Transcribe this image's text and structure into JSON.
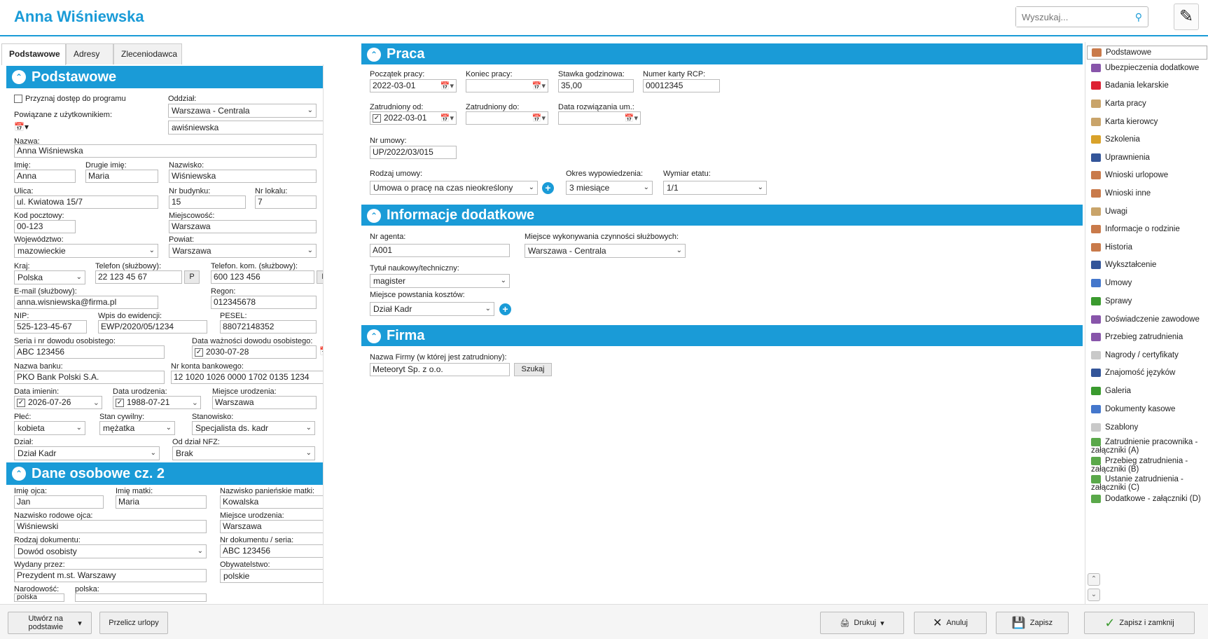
{
  "header": {
    "title": "Anna Wiśniewska",
    "search_placeholder": "Wyszukaj..."
  },
  "tabs": [
    "Podstawowe",
    "Adresy",
    "Zleceniodawca"
  ],
  "sections": {
    "podstawowe": "Podstawowe",
    "dane2": "Dane osobowe cz. 2",
    "praca": "Praca",
    "info": "Informacje dodatkowe",
    "firma": "Firma"
  },
  "podstawowe": {
    "przyznaj_label": "Przyznaj dostęp do programu",
    "oddzial_label": "Oddział:",
    "oddzial": "Warszawa - Centrala",
    "powiazane_label": "Powiązane z użytkownikiem:",
    "uzytkownik": "awiśniewska",
    "nazwa_label": "Nazwa:",
    "nazwa": "Anna Wiśniewska",
    "imie_label": "Imię:",
    "imie": "Anna",
    "drugie_label": "Drugie imię:",
    "drugie": "Maria",
    "nazwisko_label": "Nazwisko:",
    "nazwisko": "Wiśniewska",
    "ulica_label": "Ulica:",
    "ulica": "ul. Kwiatowa 15/7",
    "nrbud_label": "Nr budynku:",
    "nrbud": "15",
    "nrlok_label": "Nr lokalu:",
    "nrlok": "7",
    "kod_label": "Kod pocztowy:",
    "kod": "00-123",
    "miejsc_label": "Miejscowość:",
    "miejsc": "Warszawa",
    "woj_label": "Województwo:",
    "woj": "mazowieckie",
    "powiat_label": "Powiat:",
    "powiat": "Warszawa",
    "kraj_label": "Kraj:",
    "kraj": "Polska",
    "tel_label": "Telefon (służbowy):",
    "tel": "22 123 45 67",
    "telkom_label": "Telefon. kom. (służbowy):",
    "telkom": "600 123 456",
    "p": "P",
    "email_label": "E-mail (służbowy):",
    "email": "anna.wisniewska@firma.pl",
    "regon_label": "Regon:",
    "regon": "012345678",
    "nip_label": "NIP:",
    "nip": "525-123-45-67",
    "wpis_label": "Wpis do ewidencji:",
    "wpis": "EWP/2020/05/1234",
    "pesel_label": "PESEL:",
    "pesel": "88072148352",
    "dowod_label": "Seria i nr dowodu osobistego:",
    "dowod": "ABC 123456",
    "wazn_label": "Data ważności dowodu osobistego:",
    "wazn": "2030-07-28",
    "bank_label": "Nazwa banku:",
    "bank": "PKO Bank Polski S.A.",
    "konto_label": "Nr konta bankowego:",
    "konto": "12 1020 1026 0000 1702 0135 1234",
    "dimien_label": "Data imienin:",
    "dimien": "2026-07-26",
    "dur_label": "Data urodzenia:",
    "dur": "1988-07-21",
    "mur_label": "Miejsce urodzenia:",
    "mur": "Warszawa",
    "plec_label": "Płeć:",
    "plec": "kobieta",
    "stan_label": "Stan cywilny:",
    "stan": "mężatka",
    "stan_ow_label": "Stanowisko:",
    "stanowisko": "Specjalista ds. kadr",
    "dzial_label": "Dział:",
    "dzial": "Dział Kadr",
    "nfz_label": "Od dział NFZ:",
    "nfz": "Brak"
  },
  "dane2": {
    "ojciec_label": "Imię ojca:",
    "ojciec": "Jan",
    "matka_label": "Imię matki:",
    "matka": "Maria",
    "panienskie_label": "Nazwisko panieńskie matki:",
    "panienskie": "Kowalska",
    "rodowe_label": "Nazwisko rodowe ojca:",
    "rodowe": "Wiśniewski",
    "mur_label": "Miejsce urodzenia:",
    "mur": "Warszawa",
    "rdok_label": "Rodzaj dokumentu:",
    "rdok": "Dowód osobisty",
    "nrdok_label": "Nr dokumentu / seria:",
    "nrdok": "ABC 123456",
    "wydany_label": "Wydany przez:",
    "wydany": "Prezydent m.st. Warszawy",
    "obyw_label": "Obywatelstwo:",
    "obyw": "polskie",
    "narod_label": "Narodowość:",
    "narod": "polska",
    "polska_label": "polska:"
  },
  "praca": {
    "pocz_label": "Początek pracy:",
    "pocz": "2022-03-01",
    "koniec_label": "Koniec pracy:",
    "koniec": "",
    "stawka_label": "Stawka godzinowa:",
    "stawka": "35,00",
    "rcp_label": "Numer karty RCP:",
    "rcp": "00012345",
    "zatrod_label": "Zatrudniony od:",
    "zatrod": "2022-03-01",
    "zatrdo_label": "Zatrudniony do:",
    "zatrdo": "",
    "rozw_label": "Data rozwiązania um.:",
    "rozw": "",
    "umowa_label": "Nr umowy:",
    "umowa": "UP/2022/03/015",
    "rodzaj_label": "Rodzaj umowy:",
    "rodzaj": "Umowa o pracę na czas nieokreślony",
    "okres_label": "Okres wypowiedzenia:",
    "okres": "3 miesiące",
    "etat_label": "Wymiar etatu:",
    "etat": "1/1"
  },
  "info": {
    "agent_label": "Nr agenta:",
    "agent": "A001",
    "miejsce_label": "Miejsce wykonywania czynności służbowych:",
    "miejsce": "Warszawa - Centrala",
    "tytul_label": "Tytuł naukowy/techniczny:",
    "tytul": "magister",
    "koszt_label": "Miejsce powstania kosztów:",
    "koszt": "Dział Kadr"
  },
  "firma": {
    "nazwa_label": "Nazwa Firmy (w której jest zatrudniony):",
    "nazwa": "Meteoryt Sp. z o.o.",
    "szukaj": "Szukaj"
  },
  "nav": [
    "Podstawowe",
    "Ubezpieczenia dodatkowe",
    "Badania lekarskie",
    "Karta pracy",
    "Karta kierowcy",
    "Szkolenia",
    "Uprawnienia",
    "Wnioski urlopowe",
    "Wnioski inne",
    "Uwagi",
    "Informacje o rodzinie",
    "Historia",
    "Wykształcenie",
    "Umowy",
    "Sprawy",
    "Doświadczenie zawodowe",
    "Przebieg zatrudnienia",
    "Nagrody / certyfikaty",
    "Znajomość języków",
    "Galeria",
    "Dokumenty kasowe",
    "Szablony",
    "Zatrudnienie pracownika - załączniki (A)",
    "Przebieg zatrudnienia - załączniki (B)",
    "Ustanie zatrudnienia - załączniki (C)",
    "Dodatkowe - załączniki (D)"
  ],
  "footer": {
    "utworz": "Utwórz na podstawie",
    "przelicz": "Przelicz urlopy",
    "drukuj": "Drukuj",
    "anuluj": "Anuluj",
    "zapisz": "Zapisz",
    "zapisz_zamknij": "Zapisz i zamknij"
  },
  "colors": {
    "accent": "#1a9bd7"
  }
}
